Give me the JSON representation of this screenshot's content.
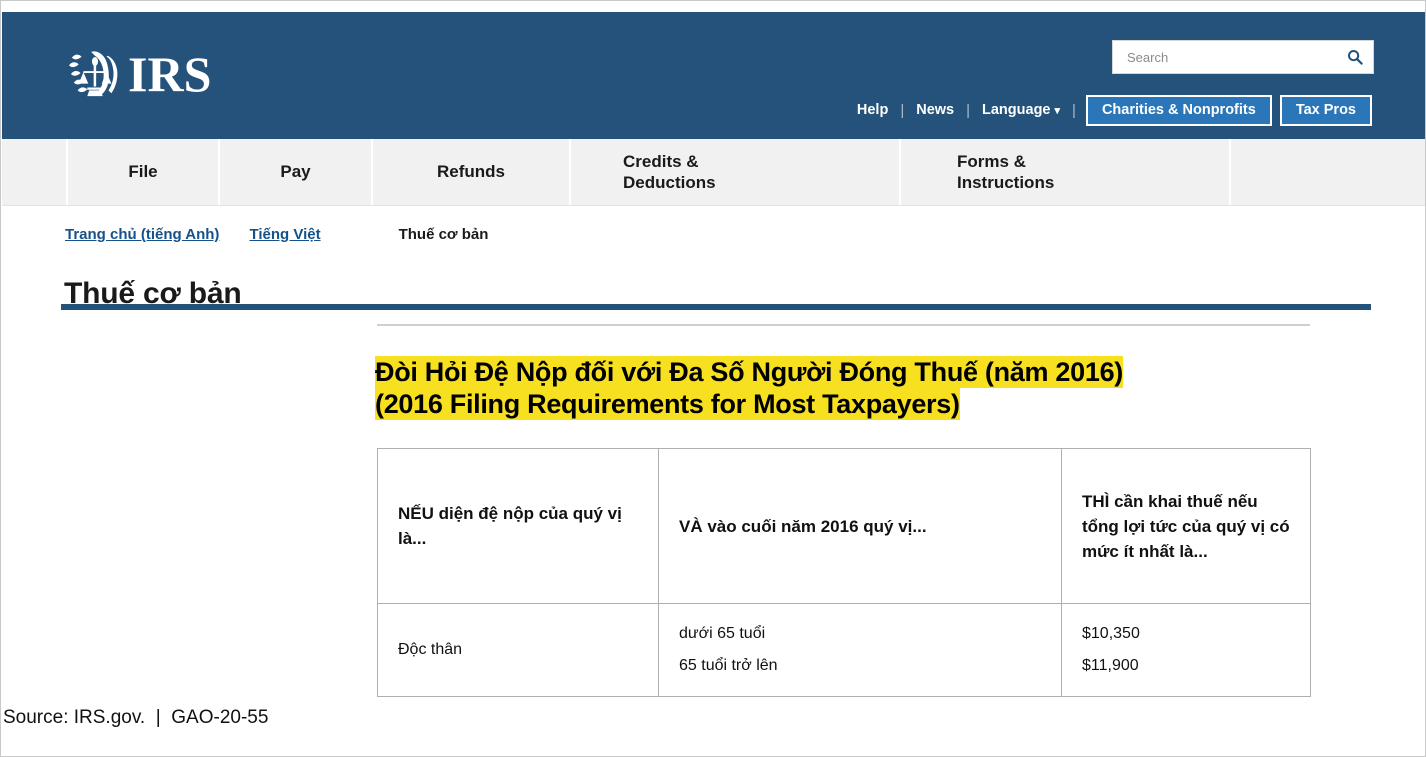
{
  "header": {
    "logo_text": "IRS",
    "logo_icon": "irs-eagle-seal-icon",
    "search": {
      "placeholder": "Search",
      "value": "",
      "icon": "search-icon"
    },
    "utility_nav": {
      "help": "Help",
      "news": "News",
      "language": "Language",
      "language_caret": "⌄",
      "separator": "|",
      "charities_button": "Charities & Nonprofits",
      "tax_pros_button": "Tax Pros"
    }
  },
  "main_nav": {
    "items": [
      {
        "label": "File"
      },
      {
        "label": "Pay"
      },
      {
        "label": "Refunds"
      },
      {
        "label": "Credits &\nDeductions"
      },
      {
        "label": "Forms &\nInstructions"
      }
    ]
  },
  "breadcrumb": {
    "home": "Trang chủ (tiếng Anh)",
    "language": "Tiếng Việt",
    "current": "Thuế cơ bản"
  },
  "page": {
    "title": "Thuế cơ bản",
    "heading_line1": "Đòi Hỏi Đệ Nộp đối với Đa Số Người Đóng Thuế (năm 2016)",
    "heading_line2": "(2016 Filing Requirements for Most Taxpayers)",
    "highlight_color": "#f7e01f"
  },
  "table": {
    "headers": [
      "NẾU diện đệ nộp của quý vị là...",
      "VÀ vào cuối năm 2016 quý vị...",
      "THÌ cần khai thuế nếu tổng lợi tức của quý vị có mức ít nhất là..."
    ],
    "rows": [
      {
        "status": "Độc thân",
        "age_line1": "dưới 65 tuổi",
        "age_line2": "65 tuổi trở lên",
        "amount_line1": "$10,350",
        "amount_line2": "$11,900"
      }
    ]
  },
  "footer": {
    "source": "Source: IRS.gov.  |  GAO-20-55"
  },
  "colors": {
    "header_blue": "#24527a",
    "button_blue": "#2b76b9",
    "link_blue": "#16528a",
    "nav_gray": "#f1f1f1",
    "highlight_yellow": "#f7e01f"
  }
}
